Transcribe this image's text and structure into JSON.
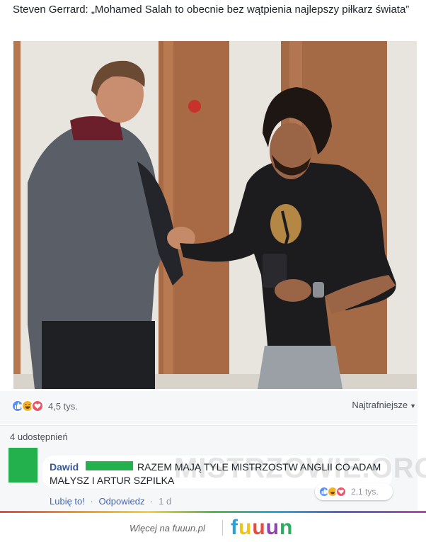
{
  "post": {
    "title": "Steven Gerrard: „Mohamed Salah to obecnie bez wątpienia najlepszy piłkarz świata”"
  },
  "reactions": {
    "icons": [
      "like-icon",
      "haha-icon",
      "love-icon"
    ],
    "count": "4,5 tys.",
    "sort_label": "Najtrafniejsze"
  },
  "shares": {
    "label": "4 udostępnień"
  },
  "comment": {
    "author": "Dawid",
    "text": "RAZEM MAJĄ TYLE MISTRZOSTW ANGLII CO ADAM MAŁYSZ I ARTUR SZPILKA",
    "reaction_count": "2,1 tys.",
    "like_label": "Lubię to!",
    "reply_label": "Odpowiedz",
    "time": "1 d"
  },
  "watermark": "MISTRZOWIE.ORG",
  "footer": {
    "text": "Więcej na fuuun.pl",
    "logo_letters": [
      "f",
      "u",
      "u",
      "u",
      "n"
    ]
  },
  "colors": {
    "link": "#365899",
    "like": "#5890ff",
    "haha": "#f7b125",
    "love": "#f25268",
    "redaction": "#22b14c"
  }
}
